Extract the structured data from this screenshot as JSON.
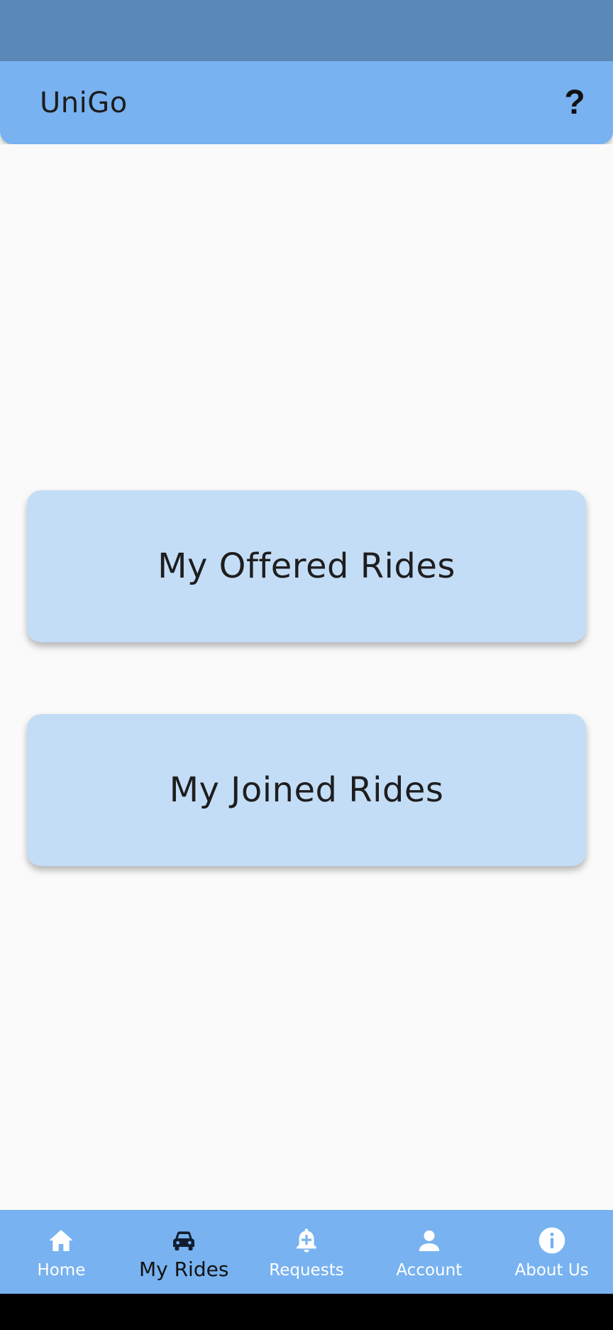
{
  "app": {
    "title": "UniGo",
    "help_label": "?"
  },
  "main": {
    "offered_rides_label": "My Offered Rides",
    "joined_rides_label": "My Joined Rides"
  },
  "bottom_nav": {
    "items": [
      {
        "label": "Home",
        "icon": "home-icon"
      },
      {
        "label": "My Rides",
        "icon": "car-icon",
        "active": true
      },
      {
        "label": "Requests",
        "icon": "bell-plus-icon"
      },
      {
        "label": "Account",
        "icon": "person-icon"
      },
      {
        "label": "About Us",
        "icon": "info-icon"
      }
    ]
  },
  "colors": {
    "status_bar": "#5b89b7",
    "app_bar": "#78b2f0",
    "card": "#c4ddf7",
    "background": "#fafafa"
  }
}
